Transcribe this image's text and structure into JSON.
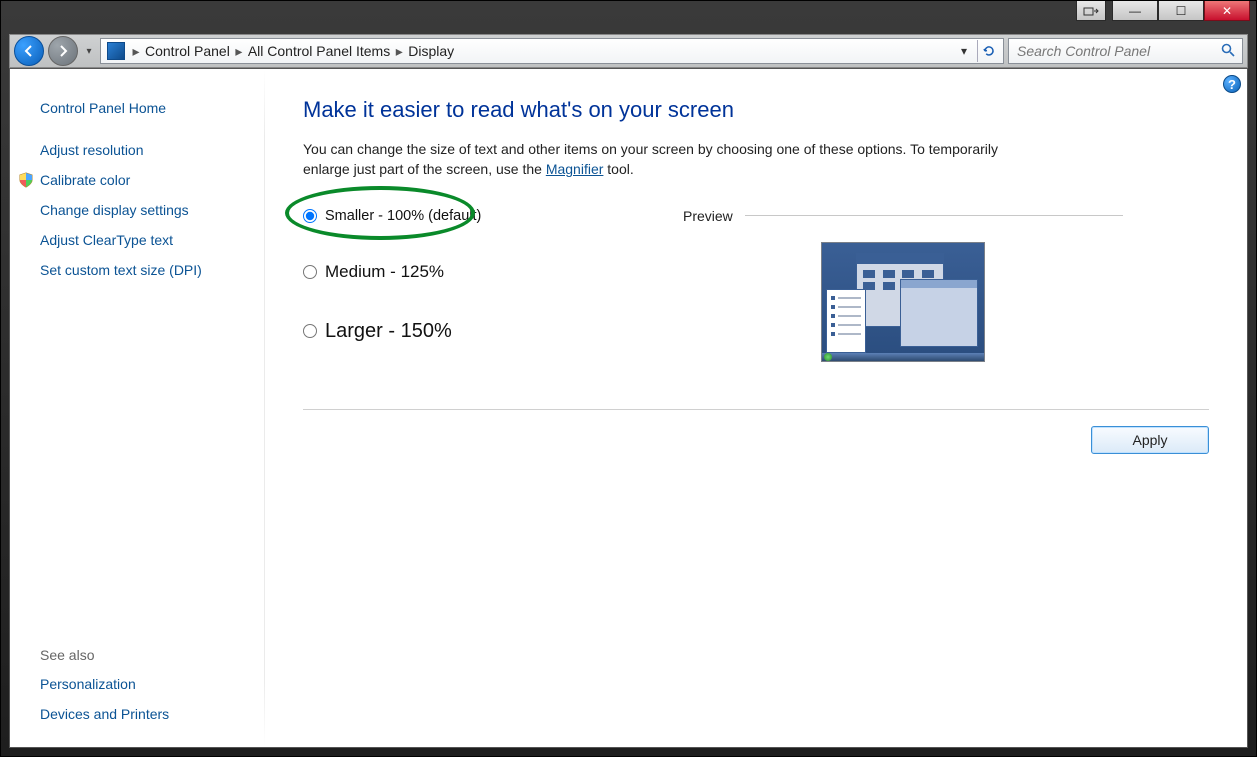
{
  "caption": {
    "restore_icon": "⧉",
    "minimize_icon": "—",
    "maximize_icon": "☐",
    "close_icon": "✕"
  },
  "nav": {
    "breadcrumb": [
      "Control Panel",
      "All Control Panel Items",
      "Display"
    ],
    "search_placeholder": "Search Control Panel"
  },
  "sidebar": {
    "home": "Control Panel Home",
    "tasks": [
      "Adjust resolution",
      "Calibrate color",
      "Change display settings",
      "Adjust ClearType text",
      "Set custom text size (DPI)"
    ],
    "see_also_heading": "See also",
    "see_also": [
      "Personalization",
      "Devices and Printers"
    ]
  },
  "main": {
    "heading": "Make it easier to read what's on your screen",
    "desc_pre": "You can change the size of text and other items on your screen by choosing one of these options. To temporarily enlarge just part of the screen, use the ",
    "magnifier_link": "Magnifier",
    "desc_post": " tool.",
    "options": [
      {
        "label": "Smaller - 100% (default)",
        "selected": true,
        "size": "small"
      },
      {
        "label": "Medium - 125%",
        "selected": false,
        "size": "medium"
      },
      {
        "label": "Larger - 150%",
        "selected": false,
        "size": "larger"
      }
    ],
    "preview_label": "Preview",
    "apply_label": "Apply",
    "help_icon": "?"
  }
}
